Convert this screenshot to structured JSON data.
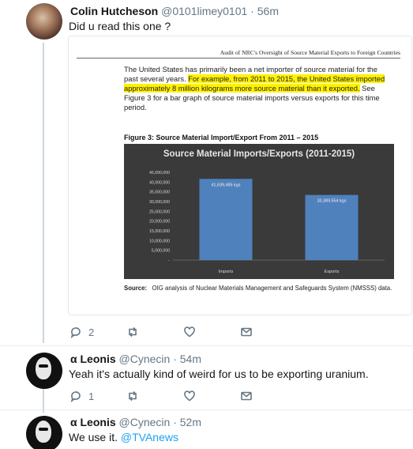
{
  "tweets": [
    {
      "author_name": "Colin Hutcheson",
      "handle": "@0101limey0101",
      "time": "56m",
      "text": "Did u read this one ?",
      "reply_count": "2",
      "retweet_count": "",
      "like_count": ""
    },
    {
      "author_name": "α Leonis",
      "handle": "@Cynecin",
      "time": "54m",
      "text": "Yeah it's actually kind of weird for us to be exporting uranium.",
      "reply_count": "1",
      "retweet_count": "",
      "like_count": ""
    },
    {
      "author_name": "α Leonis",
      "handle": "@Cynecin",
      "time": "52m",
      "text": "We use it.",
      "mention": "@TVAnews"
    }
  ],
  "separator": " · ",
  "document": {
    "header": "Audit of NRC's Oversight of Source Material Exports to Foreign Countries",
    "para_plain_1": "The United States has primarily been a net importer of source material for the past several years.  ",
    "para_highlight": "For example, from 2011 to 2015, the United States imported approximately 8 million kilograms more source material than it exported.",
    "para_plain_2": "  See Figure 3 for a bar graph of source material imports versus exports for this time period.",
    "figure_caption": "Figure 3:  Source Material Import/Export From 2011 – 2015",
    "source_label": "Source:",
    "source_text": "OIG analysis of Nuclear Materials Management and Safeguards System (NMSSS) data."
  },
  "chart_data": {
    "type": "bar",
    "title": "Source Material Imports/Exports (2011-2015)",
    "categories": [
      "Imports",
      "Exports"
    ],
    "values": [
      41639485,
      33389554
    ],
    "data_labels": [
      "41,639,485 kgs",
      "33,389,554 kgs"
    ],
    "ylim": [
      0,
      45000000
    ],
    "yticks": [
      "45,000,000",
      "40,000,000",
      "35,000,000",
      "30,000,000",
      "25,000,000",
      "20,000,000",
      "15,000,000",
      "10,000,000",
      "5,000,000",
      "-"
    ],
    "bar_color": "#4f81bd",
    "background_color": "#3a3a3a"
  },
  "colors": {
    "link": "#1da1f2",
    "muted": "#657786",
    "thread_line": "#ccd6dd"
  }
}
